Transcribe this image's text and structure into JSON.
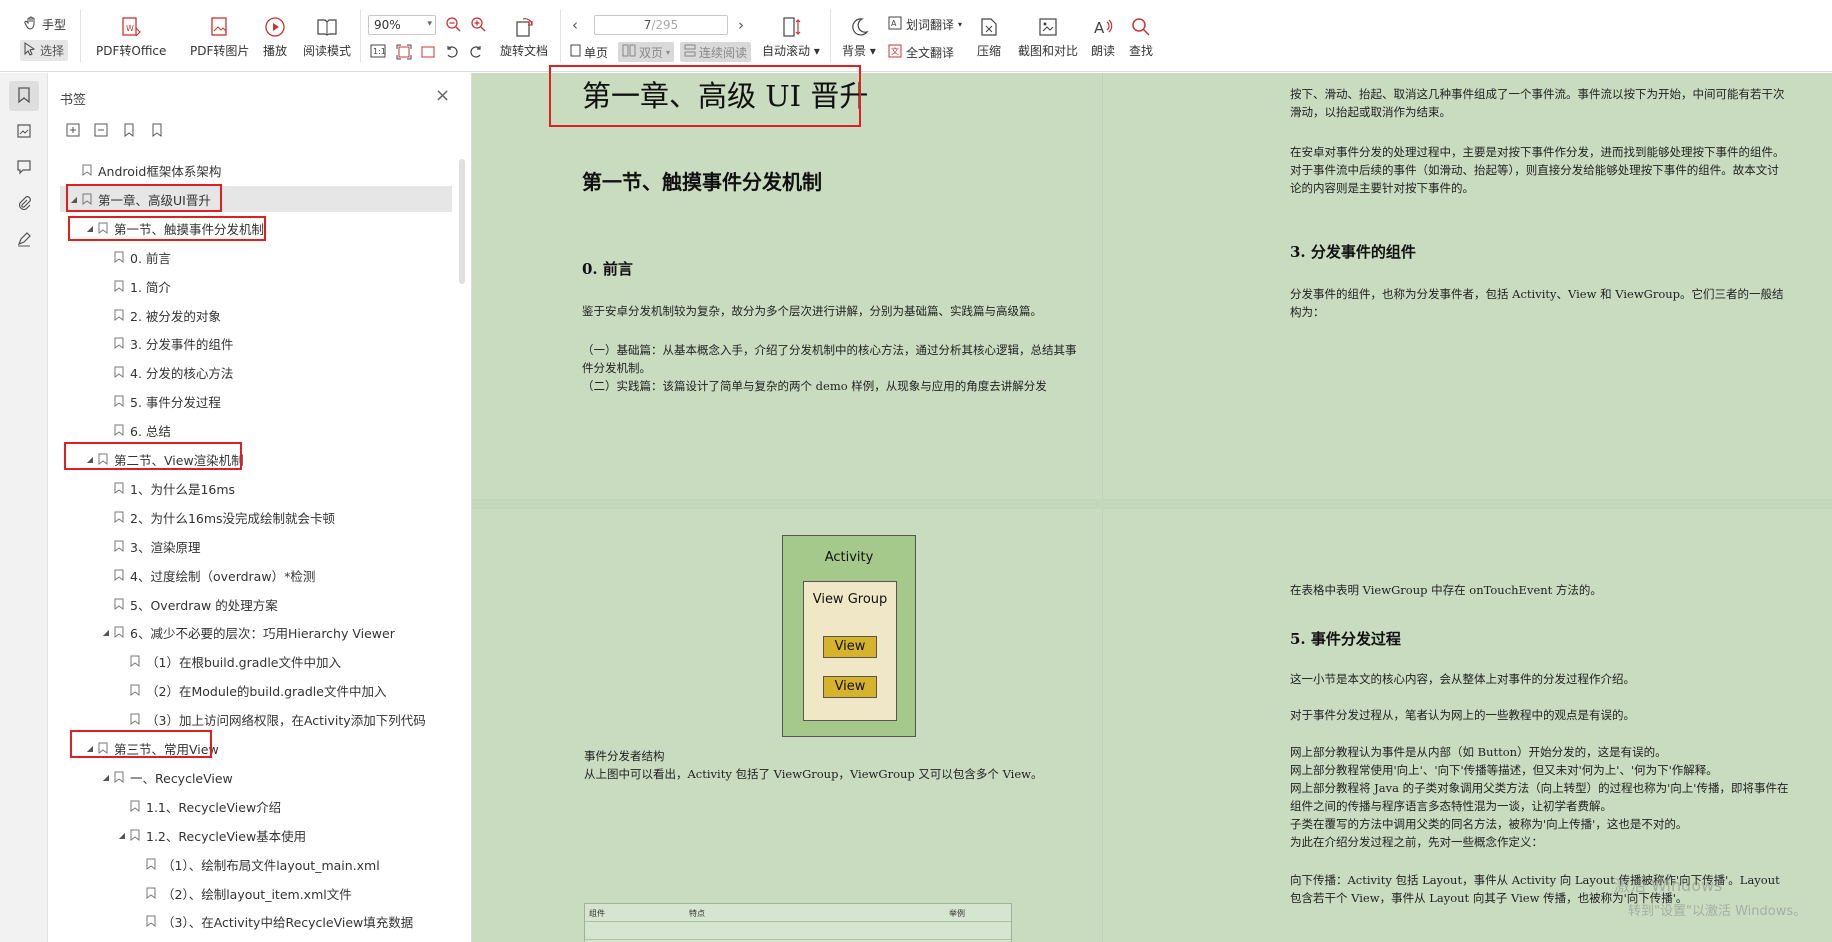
{
  "toolbar": {
    "hand_tool": "手型",
    "select_tool": "选择",
    "pdf_to_office": "PDF转Office",
    "pdf_to_image": "PDF转图片",
    "play": "播放",
    "read_mode": "阅读模式",
    "zoom_value": "90%",
    "rotate_doc": "旋转文档",
    "page_current": "7",
    "page_total": "/295",
    "single_page": "单页",
    "double_page": "双页",
    "continuous_read": "连续阅读",
    "auto_scroll": "自动滚动",
    "background": "背景",
    "word_translate": "划词翻译",
    "full_translate": "全文翻译",
    "compress": "压缩",
    "screenshot_compare": "截图和对比",
    "read_aloud": "朗读",
    "find": "查找"
  },
  "panel": {
    "title": "书签"
  },
  "bookmarks": [
    {
      "label": "Android框架体系架构"
    },
    {
      "label": "第一章、高级UI晋升"
    },
    {
      "label": "第一节、触摸事件分发机制"
    },
    {
      "label": "0. 前言"
    },
    {
      "label": "1. 简介"
    },
    {
      "label": "2. 被分发的对象"
    },
    {
      "label": "3. 分发事件的组件"
    },
    {
      "label": "4. 分发的核心方法"
    },
    {
      "label": "5. 事件分发过程"
    },
    {
      "label": "6. 总结"
    },
    {
      "label": "第二节、View渲染机制"
    },
    {
      "label": "1、为什么是16ms"
    },
    {
      "label": "2、为什么16ms没完成绘制就会卡顿"
    },
    {
      "label": "3、渲染原理"
    },
    {
      "label": "4、过度绘制（overdraw）*检测"
    },
    {
      "label": "5、Overdraw 的处理方案"
    },
    {
      "label": "6、减少不必要的层次：巧用Hierarchy Viewer"
    },
    {
      "label": "（1）在根build.gradle文件中加入"
    },
    {
      "label": "（2）在Module的build.gradle文件中加入"
    },
    {
      "label": "（3）加上访问网络权限，在Activity添加下列代码"
    },
    {
      "label": "第三节、常用View"
    },
    {
      "label": "一、RecycleView"
    },
    {
      "label": "1.1、RecycleView介绍"
    },
    {
      "label": "1.2、RecycleView基本使用"
    },
    {
      "label": "（1）、绘制布局文件layout_main.xml"
    },
    {
      "label": "（2）、绘制layout_item.xml文件"
    },
    {
      "label": "（3）、在Activity中给RecycleView填充数据"
    }
  ],
  "doc": {
    "chapter_title": "第一章、高级 UI 晋升",
    "section_title": "第一节、触摸事件分发机制",
    "preface_heading": "0.  前言",
    "preface_p1": "鉴于安卓分发机制较为复杂，故分为多个层次进行讲解，分别为基础篇、实践篇与高级篇。",
    "preface_p2": "（一）基础篇：从基本概念入手，介绍了分发机制中的核心方法，通过分析其核心逻辑，总结其事件分发机制。",
    "preface_p3": "（二）实践篇：该篇设计了简单与复杂的两个 demo 样例，从现象与应用的角度去讲解分发",
    "right_p1": "按下、滑动、抬起、取消这几种事件组成了一个事件流。事件流以按下为开始，中间可能有若干次滑动，以抬起或取消作为结束。",
    "right_p2": "在安卓对事件分发的处理过程中，主要是对按下事件作分发，进而找到能够处理按下事件的组件。对于事件流中后续的事件（如滑动、抬起等），则直接分发给能够处理按下事件的组件。故本文讨论的内容则是主要针对按下事件的。",
    "heading_3": "3.  分发事件的组件",
    "right_p3": "分发事件的组件，也称为分发事件者，包括 Activity、View 和 ViewGroup。它们三者的一般结构为：",
    "diagram": {
      "activity": "Activity",
      "view_group": "View Group",
      "view1": "View",
      "view2": "View"
    },
    "caption1": "事件分发者结构",
    "caption2": "从上图中可以看出，Activity 包括了 ViewGroup，ViewGroup 又可以包含多个 View。",
    "table_headers": [
      "组件",
      "特点",
      "举例"
    ],
    "right_p4": "在表格中表明 ViewGroup 中存在 onTouchEvent 方法的。",
    "heading_5": "5.  事件分发过程",
    "right_p5": "这一小节是本文的核心内容，会从整体上对事件的分发过程作介绍。",
    "right_p6": "对于事件分发过程从，笔者认为网上的一些教程中的观点是有误的。",
    "right_p7a": "网上部分教程认为事件是从内部（如 Button）开始分发的，这是有误的。",
    "right_p7b": "网上部分教程常使用'向上'、'向下'传播等描述，但又未对'何为上'、'何为下'作解释。",
    "right_p7c": "网上部分教程将 Java 的子类对象调用父类方法（向上转型）的过程也称为'向上'传播，即将事件在组件之间的传播与程序语言多态特性混为一谈，让初学者费解。",
    "right_p7d": "子类在覆写的方法中调用父类的同名方法，被称为'向上传播'，这也是不对的。",
    "right_p7e": "为此在介绍分发过程之前，先对一些概念作定义：",
    "right_p8": "向下传播：Activity 包括 Layout，事件从 Activity 向 Layout 传播被称作'向下传播'。Layout 包含若干个 View，事件从 Layout 向其子 View 传播，也被称为'向下传播'。"
  },
  "watermark": {
    "line1": "激活 Windows",
    "line2": "转到\"设置\"以激活 Windows。"
  },
  "colors": {
    "doc_background": "#c9dcc0",
    "highlight_box": "#e02020"
  }
}
